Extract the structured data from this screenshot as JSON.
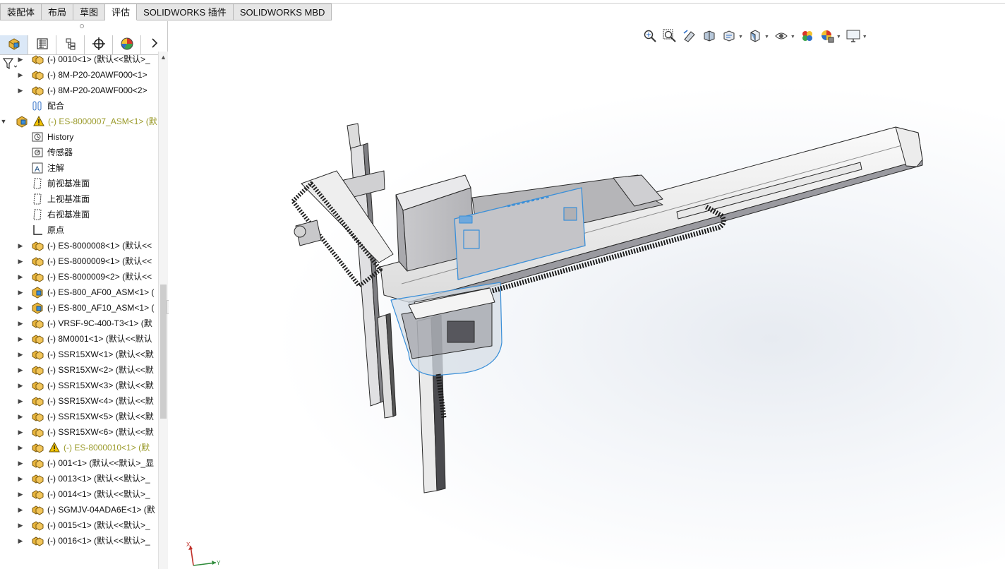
{
  "command_tabs": [
    {
      "label": "装配体",
      "active": false
    },
    {
      "label": "布局",
      "active": false
    },
    {
      "label": "草图",
      "active": false
    },
    {
      "label": "评估",
      "active": true
    },
    {
      "label": "SOLIDWORKS 插件",
      "active": false
    },
    {
      "label": "SOLIDWORKS MBD",
      "active": false
    }
  ],
  "manager_tabs": [
    {
      "icon": "feature-manager-icon",
      "active": true
    },
    {
      "icon": "property-manager-icon",
      "active": false
    },
    {
      "icon": "configuration-manager-icon",
      "active": false
    },
    {
      "icon": "dimxpert-icon",
      "active": false
    },
    {
      "icon": "display-manager-icon",
      "active": false
    }
  ],
  "tree": {
    "items": [
      {
        "label": "(-) 0010<1> (默认<<默认>_",
        "icon": "assembly-icon",
        "indent": 0,
        "expander": "collapsed"
      },
      {
        "label": "(-) 8M-P20-20AWF000<1>",
        "icon": "assembly-icon",
        "indent": 0,
        "expander": "collapsed"
      },
      {
        "label": "(-) 8M-P20-20AWF000<2>",
        "icon": "assembly-icon",
        "indent": 0,
        "expander": "collapsed"
      },
      {
        "label": "配合",
        "icon": "mates-icon",
        "indent": 0,
        "expander": "none"
      },
      {
        "label": "(-) ES-8000007_ASM<1> (默",
        "icon": "subassembly-icon",
        "indent": -1,
        "expander": "expanded",
        "warning": true
      },
      {
        "label": "History",
        "icon": "history-icon",
        "indent": 1,
        "expander": "none"
      },
      {
        "label": "传感器",
        "icon": "sensor-icon",
        "indent": 1,
        "expander": "none"
      },
      {
        "label": "注解",
        "icon": "annotation-icon",
        "indent": 1,
        "expander": "none"
      },
      {
        "label": "前视基准面",
        "icon": "plane-icon",
        "indent": 1,
        "expander": "none"
      },
      {
        "label": "上视基准面",
        "icon": "plane-icon",
        "indent": 1,
        "expander": "none"
      },
      {
        "label": "右视基准面",
        "icon": "plane-icon",
        "indent": 1,
        "expander": "none"
      },
      {
        "label": "原点",
        "icon": "origin-icon",
        "indent": 1,
        "expander": "none"
      },
      {
        "label": "(-) ES-8000008<1> (默认<<",
        "icon": "assembly-icon",
        "indent": 0,
        "expander": "collapsed"
      },
      {
        "label": "(-) ES-8000009<1> (默认<<",
        "icon": "assembly-icon",
        "indent": 0,
        "expander": "collapsed"
      },
      {
        "label": "(-) ES-8000009<2> (默认<<",
        "icon": "assembly-icon",
        "indent": 0,
        "expander": "collapsed"
      },
      {
        "label": "(-) ES-800_AF00_ASM<1> (",
        "icon": "subassembly-icon",
        "indent": 0,
        "expander": "collapsed"
      },
      {
        "label": "(-) ES-800_AF10_ASM<1> (",
        "icon": "subassembly-icon",
        "indent": 0,
        "expander": "collapsed"
      },
      {
        "label": "(-) VRSF-9C-400-T3<1> (默",
        "icon": "assembly-icon",
        "indent": 0,
        "expander": "collapsed"
      },
      {
        "label": "(-) 8M0001<1> (默认<<默认",
        "icon": "assembly-icon",
        "indent": 0,
        "expander": "collapsed"
      },
      {
        "label": "(-) SSR15XW<1> (默认<<默",
        "icon": "assembly-icon",
        "indent": 0,
        "expander": "collapsed"
      },
      {
        "label": "(-) SSR15XW<2> (默认<<默",
        "icon": "assembly-icon",
        "indent": 0,
        "expander": "collapsed"
      },
      {
        "label": "(-) SSR15XW<3> (默认<<默",
        "icon": "assembly-icon",
        "indent": 0,
        "expander": "collapsed"
      },
      {
        "label": "(-) SSR15XW<4> (默认<<默",
        "icon": "assembly-icon",
        "indent": 0,
        "expander": "collapsed"
      },
      {
        "label": "(-) SSR15XW<5> (默认<<默",
        "icon": "assembly-icon",
        "indent": 0,
        "expander": "collapsed"
      },
      {
        "label": "(-) SSR15XW<6> (默认<<默",
        "icon": "assembly-icon",
        "indent": 0,
        "expander": "collapsed"
      },
      {
        "label": "(-) ES-8000010<1> (默",
        "icon": "assembly-icon",
        "indent": 0,
        "expander": "collapsed",
        "warning": true
      },
      {
        "label": "(-) 001<1> (默认<<默认>_显",
        "icon": "assembly-icon",
        "indent": 0,
        "expander": "collapsed"
      },
      {
        "label": "(-) 0013<1> (默认<<默认>_",
        "icon": "assembly-icon",
        "indent": 0,
        "expander": "collapsed"
      },
      {
        "label": "(-) 0014<1> (默认<<默认>_",
        "icon": "assembly-icon",
        "indent": 0,
        "expander": "collapsed"
      },
      {
        "label": "(-) SGMJV-04ADA6E<1> (默",
        "icon": "assembly-icon",
        "indent": 0,
        "expander": "collapsed"
      },
      {
        "label": "(-) 0015<1> (默认<<默认>_",
        "icon": "assembly-icon",
        "indent": 0,
        "expander": "collapsed"
      },
      {
        "label": "(-) 0016<1> (默认<<默认>_",
        "icon": "assembly-icon",
        "indent": 0,
        "expander": "collapsed"
      }
    ]
  },
  "view_toolbar": [
    {
      "icon": "zoom-to-fit-icon",
      "dropdown": false
    },
    {
      "icon": "zoom-to-area-icon",
      "dropdown": false
    },
    {
      "icon": "previous-view-icon",
      "dropdown": false
    },
    {
      "icon": "section-view-icon",
      "dropdown": false
    },
    {
      "icon": "dynamic-annotation-icon",
      "dropdown": true
    },
    {
      "icon": "view-orientation-icon",
      "dropdown": true
    },
    {
      "icon": "display-style-icon",
      "dropdown": true
    },
    {
      "icon": "hide-show-items-icon",
      "dropdown": false
    },
    {
      "icon": "edit-appearance-icon",
      "dropdown": true
    },
    {
      "icon": "view-settings-icon",
      "dropdown": true
    }
  ],
  "colors": {
    "accent_selection": "#3a8fd8",
    "warning": "#e8b400",
    "assembly_icon": "#e8b43a",
    "warning_text": "#9a9a2a"
  }
}
